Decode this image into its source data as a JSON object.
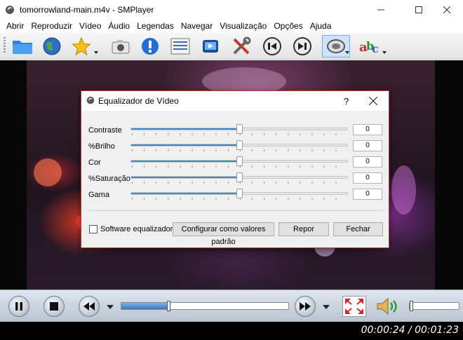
{
  "window": {
    "title": "tomorrowland-main.m4v - SMPlayer",
    "icon": "smplayer-icon",
    "controls": [
      "minimize-icon",
      "maximize-icon",
      "close-icon"
    ]
  },
  "menu": {
    "items": [
      {
        "label": "Abrir"
      },
      {
        "label": "Reproduzir"
      },
      {
        "label": "Vídeo"
      },
      {
        "label": "Áudio"
      },
      {
        "label": "Legendas"
      },
      {
        "label": "Navegar"
      },
      {
        "label": "Visualização"
      },
      {
        "label": "Opções"
      },
      {
        "label": "Ajuda"
      }
    ]
  },
  "toolbar": {
    "buttons": [
      "open-folder-icon",
      "open-url-globe-icon",
      "favorites-star-icon",
      "screenshot-camera-icon",
      "info-icon",
      "playlist-icon",
      "fullscreen-icon",
      "preferences-tools-icon",
      "previous-chapter-icon",
      "next-chapter-icon",
      "equalizer-icon",
      "subtitles-abc-icon"
    ]
  },
  "dialog": {
    "title": "Equalizador de Vídeo",
    "help": "?",
    "sliders": [
      {
        "label": "Contraste",
        "value": "0",
        "fraction": 0.5
      },
      {
        "label": "%Brilho",
        "value": "0",
        "fraction": 0.5
      },
      {
        "label": "Cor",
        "value": "0",
        "fraction": 0.5
      },
      {
        "label": "%Saturação",
        "value": "0",
        "fraction": 0.5
      },
      {
        "label": "Gama",
        "value": "0",
        "fraction": 0.5
      }
    ],
    "software_checkbox_label": "Software equalizador",
    "software_checked": false,
    "defaults_button": "Configurar como valores padrão",
    "reset_button": "Repor",
    "close_button": "Fechar"
  },
  "controls": {
    "seek_fraction": 0.29,
    "volume_fraction": 0.05,
    "time": "00:00:24 / 00:01:23"
  },
  "colors": {
    "accent": "#3b8ad9",
    "dialog_border": "#cc3333"
  }
}
